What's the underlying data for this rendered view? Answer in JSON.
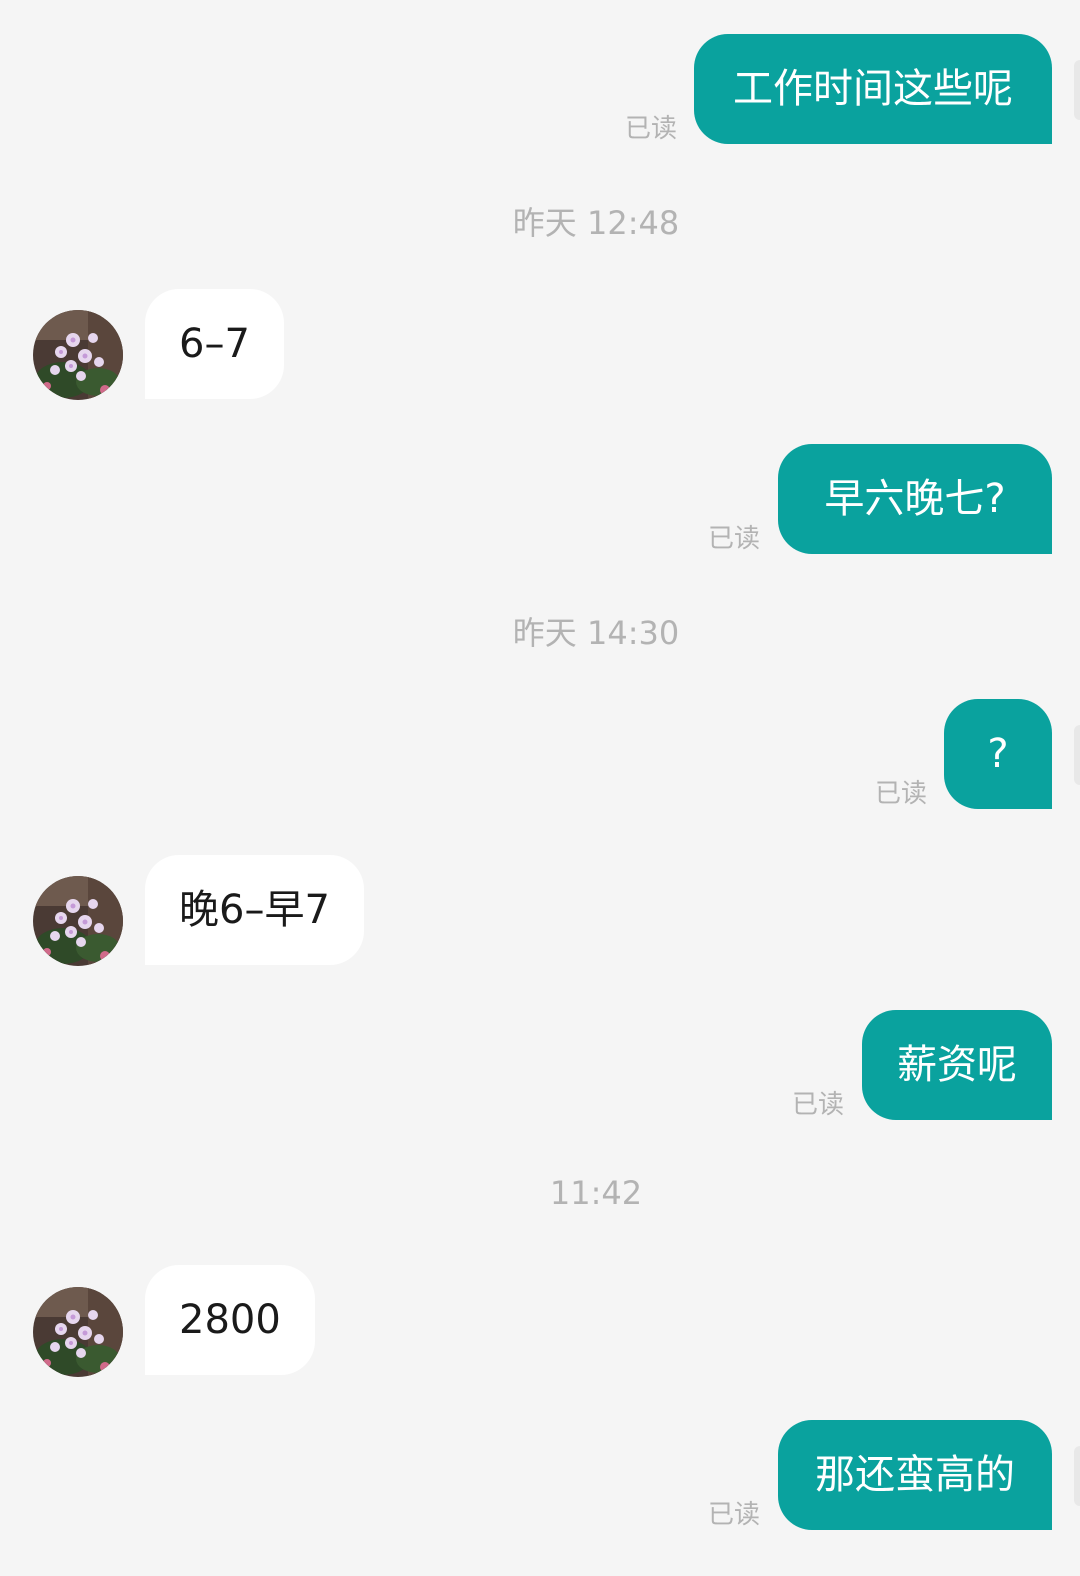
{
  "messages": [
    {
      "type": "outgoing",
      "text": "工作时间这些呢",
      "status": "已读"
    },
    {
      "type": "timestamp",
      "text": "昨天 12:48"
    },
    {
      "type": "incoming",
      "text": "6–7"
    },
    {
      "type": "outgoing",
      "text": "早六晚七?",
      "status": "已读"
    },
    {
      "type": "timestamp",
      "text": "昨天 14:30"
    },
    {
      "type": "outgoing",
      "text": "?",
      "status": "已读"
    },
    {
      "type": "incoming",
      "text": "晚6–早7"
    },
    {
      "type": "outgoing",
      "text": "薪资呢",
      "status": "已读"
    },
    {
      "type": "timestamp",
      "text": "11:42"
    },
    {
      "type": "incoming",
      "text": "2800"
    },
    {
      "type": "outgoing",
      "text": "那还蛮高的",
      "status": "已读"
    }
  ],
  "colors": {
    "background": "#f5f5f5",
    "outgoing_bubble": "#0aa29e",
    "incoming_bubble": "#ffffff",
    "meta_text": "#b3b3b3"
  },
  "icons": {
    "avatar": "flower-avatar-icon"
  }
}
